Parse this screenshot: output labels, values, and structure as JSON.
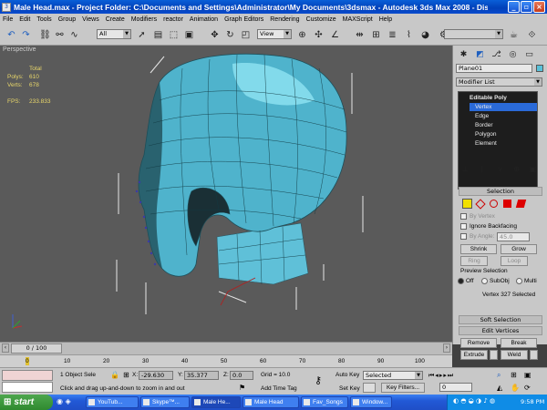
{
  "window": {
    "title": "Male Head.max   - Project Folder: C:\\Documents and Settings\\Administrator\\My Documents\\3dsmax   - Autodesk 3ds Max 2008   - Display : Di..."
  },
  "menu": [
    "File",
    "Edit",
    "Tools",
    "Group",
    "Views",
    "Create",
    "Modifiers",
    "reactor",
    "Animation",
    "Graph Editors",
    "Rendering",
    "Customize",
    "MAXScript",
    "Help"
  ],
  "toolbar": {
    "selection_filter": "All",
    "ref_coord": "View"
  },
  "viewport": {
    "label": "Perspective",
    "stats": {
      "total_label": "Total",
      "polys_label": "Polys:",
      "polys": "610",
      "verts_label": "Verts:",
      "verts": "678",
      "fps_label": "FPS:",
      "fps": "233.833"
    }
  },
  "command_panel": {
    "object_name": "Plane01",
    "object_color": "#59c1d9",
    "modifier_list": "Modifier List",
    "stack": [
      "Editable Poly",
      "Vertex",
      "Edge",
      "Border",
      "Polygon",
      "Element"
    ],
    "selection": {
      "title": "Selection",
      "by_vertex": "By Vertex",
      "ignore_backfacing": "Ignore Backfacing",
      "by_angle": "By Angle:",
      "angle_value": "45.0",
      "shrink": "Shrink",
      "grow": "Grow",
      "ring": "Ring",
      "loop": "Loop",
      "preview_title": "Preview Selection",
      "preview_options": [
        "Off",
        "SubObj",
        "Multi"
      ],
      "status": "Vertex 327 Selected"
    },
    "soft_selection": "Soft Selection",
    "edit_vertices": {
      "title": "Edit Vertices",
      "remove": "Remove",
      "break": "Break",
      "extrude": "Extrude",
      "weld": "Weld"
    }
  },
  "timeline": {
    "frame": "0 / 100",
    "ticks": [
      "0",
      "10",
      "20",
      "30",
      "40",
      "50",
      "60",
      "70",
      "80",
      "90",
      "100"
    ]
  },
  "status": {
    "selection_count": "1 Object Sele",
    "x_label": "X:",
    "x": "-29.630",
    "y_label": "Y:",
    "y": "35.377",
    "z_label": "Z:",
    "z": "0.0",
    "grid": "Grid = 10.0",
    "prompt": "Click and drag up-and-down to zoom in and out",
    "add_time_tag": "Add Time Tag",
    "auto_key": "Auto Key",
    "set_key": "Set Key",
    "key_mode": "Selected",
    "key_filters": "Key Filters...",
    "current_frame": "0"
  },
  "taskbar": {
    "start": "start",
    "tasks": [
      "YouTub...",
      "Skype™...",
      "Male He...",
      "Male Head",
      "Fav_Songs",
      "Window..."
    ],
    "time": "9:58 PM"
  }
}
